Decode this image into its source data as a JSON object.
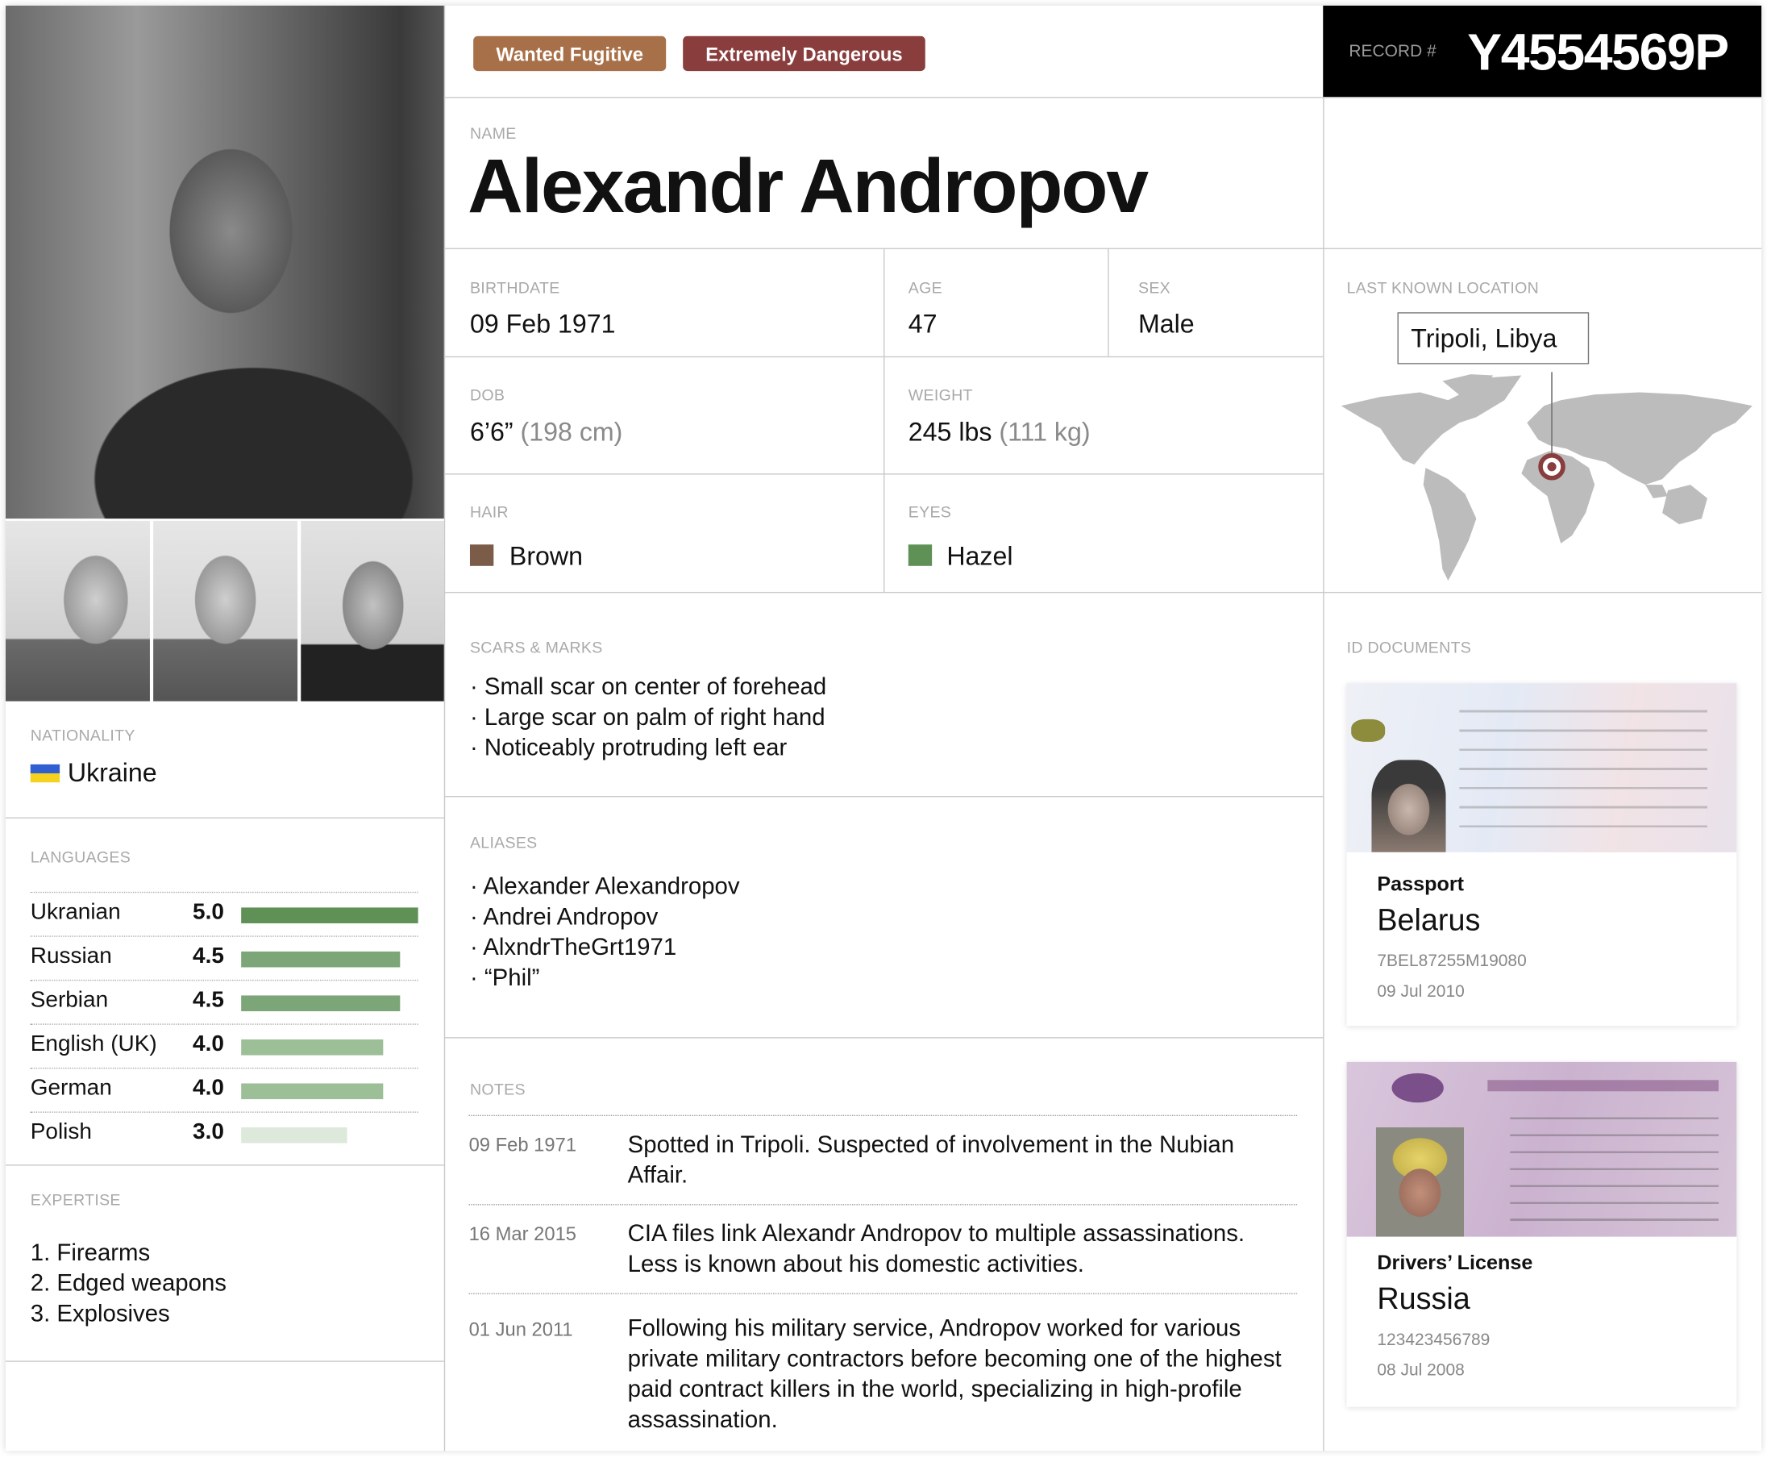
{
  "badges": [
    {
      "label": "Wanted Fugitive",
      "color": "#a87048"
    },
    {
      "label": "Extremely Dangerous",
      "color": "#8a3d3d"
    }
  ],
  "record": {
    "label": "RECORD #",
    "value": "Y4554569P"
  },
  "name": {
    "label": "NAME",
    "value": "Alexandr Andropov"
  },
  "birthdate": {
    "label": "BIRTHDATE",
    "value": "09 Feb 1971"
  },
  "age": {
    "label": "AGE",
    "value": "47"
  },
  "sex": {
    "label": "SEX",
    "value": "Male"
  },
  "height": {
    "label": "DOB",
    "value": "6’6”",
    "secondary": "(198 cm)"
  },
  "weight": {
    "label": "WEIGHT",
    "value": "245 lbs",
    "secondary": "(111 kg)"
  },
  "hair": {
    "label": "HAIR",
    "value": "Brown",
    "color": "#7a5c48"
  },
  "eyes": {
    "label": "EYES",
    "value": "Hazel",
    "color": "#5f9157"
  },
  "location": {
    "label": "LAST KNOWN LOCATION",
    "value": "Tripoli, Libya",
    "pin_color": "#8a3d3d"
  },
  "nationality": {
    "label": "NATIONALITY",
    "value": "Ukraine",
    "flag": [
      "#2f5fd0",
      "#f5d21f"
    ]
  },
  "languages": {
    "label": "LANGUAGES",
    "max": 5,
    "items": [
      {
        "name": "Ukranian",
        "score": "5.0",
        "value": 5.0,
        "color": "#5f9157"
      },
      {
        "name": "Russian",
        "score": "4.5",
        "value": 4.5,
        "color": "#7ca677"
      },
      {
        "name": "Serbian",
        "score": "4.5",
        "value": 4.5,
        "color": "#7ca677"
      },
      {
        "name": "English (UK)",
        "score": "4.0",
        "value": 4.0,
        "color": "#9dbf97"
      },
      {
        "name": "German",
        "score": "4.0",
        "value": 4.0,
        "color": "#9dbf97"
      },
      {
        "name": "Polish",
        "score": "3.0",
        "value": 3.0,
        "color": "#dde9db"
      }
    ]
  },
  "expertise": {
    "label": "EXPERTISE",
    "items": [
      "1. Firearms",
      "2. Edged weapons",
      "3. Explosives"
    ]
  },
  "scars": {
    "label": "SCARS & MARKS",
    "items": [
      "Small scar on center of forehead",
      "Large scar on palm of right hand",
      "Noticeably protruding left ear"
    ]
  },
  "aliases": {
    "label": "ALIASES",
    "items": [
      "Alexander Alexandropov",
      "Andrei Andropov",
      "AlxndrTheGrt1971",
      "“Phil”"
    ]
  },
  "notes": {
    "label": "NOTES",
    "items": [
      {
        "date": "09 Feb 1971",
        "text": "Spotted in Tripoli. Suspected of involvement in the Nubian Affair."
      },
      {
        "date": "16 Mar 2015",
        "text": "CIA files link Alexandr Andropov to multiple assassinations. Less is known about his domestic activities."
      },
      {
        "date": "01 Jun 2011",
        "text": "Following his military service, Andropov worked for various private military contractors before becoming one of the highest paid contract killers in the world, specializing in high-profile assassination."
      }
    ]
  },
  "documents": {
    "label": "ID DOCUMENTS",
    "items": [
      {
        "type": "Passport",
        "country": "Belarus",
        "number": "7BEL87255M19080",
        "date": "09 Jul 2010"
      },
      {
        "type": "Drivers’ License",
        "country": "Russia",
        "number": "123423456789",
        "date": "08 Jul 2008"
      }
    ]
  }
}
